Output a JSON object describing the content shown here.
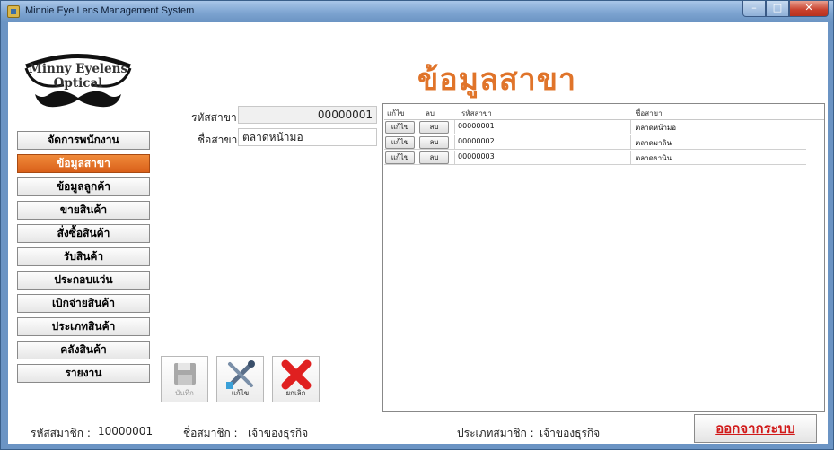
{
  "window": {
    "title": "Minnie Eye Lens Management System"
  },
  "logo": {
    "text": "Minny Eyelens Optical"
  },
  "page_title": "ข้อมูลสาขา",
  "sidebar": {
    "items": [
      {
        "label": "จัดการพนักงาน",
        "active": false
      },
      {
        "label": "ข้อมูลสาขา",
        "active": true
      },
      {
        "label": "ข้อมูลลูกค้า",
        "active": false
      },
      {
        "label": "ขายสินค้า",
        "active": false
      },
      {
        "label": "สั่งซื้อสินค้า",
        "active": false
      },
      {
        "label": "รับสินค้า",
        "active": false
      },
      {
        "label": "ประกอบแว่น",
        "active": false
      },
      {
        "label": "เบิกจ่ายสินค้า",
        "active": false
      },
      {
        "label": "ประเภทสินค้า",
        "active": false
      },
      {
        "label": "คลังสินค้า",
        "active": false
      },
      {
        "label": "รายงาน",
        "active": false
      }
    ]
  },
  "form": {
    "branch_code_label": "รหัสสาขา",
    "branch_code_value": "00000001",
    "branch_name_label": "ชื่อสาขา",
    "branch_name_value": "ตลาดหน้ามอ"
  },
  "grid": {
    "columns": [
      "แก้ไข",
      "ลบ",
      "รหัสสาขา",
      "ชื่อสาขา"
    ],
    "edit_button_label": "แก้ไข",
    "delete_button_label": "ลบ",
    "rows": [
      {
        "code": "00000001",
        "name": "ตลาดหน้ามอ"
      },
      {
        "code": "00000002",
        "name": "ตลาดมาลิน"
      },
      {
        "code": "00000003",
        "name": "ตลาดธานิน"
      }
    ]
  },
  "toolbar": {
    "save_label": "บันทึก",
    "edit_label": "แก้ไข",
    "cancel_label": "ยกเลิก"
  },
  "status": {
    "member_id_label": "รหัสสมาชิก :",
    "member_id_value": "10000001",
    "member_name_label": "ชื่อสมาชิก :",
    "member_name_value": "เจ้าของธุรกิจ",
    "member_type_label": "ประเภทสมาชิก :",
    "member_type_value": "เจ้าของธุรกิจ",
    "logout_label": "ออกจากระบบ"
  },
  "colors": {
    "accent": "#e0742a",
    "active_nav": "#d9601a",
    "logout_text": "#d11a1a",
    "titlebar": "#7da4d1"
  }
}
